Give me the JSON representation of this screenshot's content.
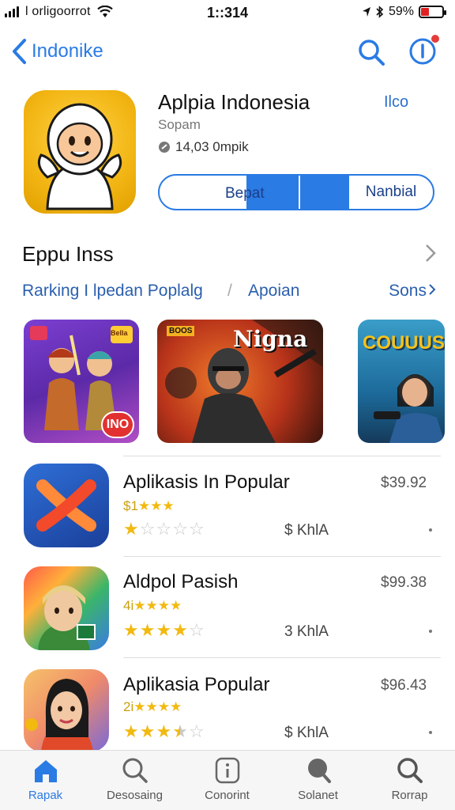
{
  "status_bar": {
    "carrier": "l orligoorrot",
    "time": "1::314",
    "battery": "59%",
    "battery_color": "#e02020"
  },
  "nav": {
    "back_label": "Indonike",
    "accent": "#2a7be4"
  },
  "app": {
    "title": "Aplpia Indonesia",
    "badge": "Ilco",
    "subtitle": "Sopam",
    "meta": "14,03 0mpik",
    "button_left": "Bepat",
    "button_right": "Nanbial"
  },
  "section": {
    "title": "Eppu Inss",
    "rank_left": "Rarking I lpedan Poplalg",
    "rank_sep": "/",
    "rank_mid": "Apoian",
    "rank_right": "Sons"
  },
  "banners": [
    {
      "tag": "INO",
      "top_tag": "Bella"
    },
    {
      "tag": "Nigna",
      "top_tag": "BOOS"
    },
    {
      "tag": "COUUUS",
      "top_tag": ""
    }
  ],
  "list": [
    {
      "title": "Aplikasis In Popular",
      "price": "$39.92",
      "sub": "$1",
      "rating": 1,
      "size": "$ KhlA"
    },
    {
      "title": "Aldpol Pasish",
      "price": "$99.38",
      "sub": "4i",
      "rating": 4,
      "size": "3 KhlA"
    },
    {
      "title": "Aplikasia Popular",
      "price": "$96.43",
      "sub": "2i",
      "rating": 3.5,
      "size": "$ KhlA"
    }
  ],
  "tabs": [
    {
      "label": "Rapak",
      "icon": "home-icon",
      "active": true
    },
    {
      "label": "Desosaing",
      "icon": "search-icon",
      "active": false
    },
    {
      "label": "Conorint",
      "icon": "info-icon",
      "active": false
    },
    {
      "label": "Solanet",
      "icon": "chat-icon",
      "active": false
    },
    {
      "label": "Rorrap",
      "icon": "search-icon",
      "active": false
    }
  ]
}
